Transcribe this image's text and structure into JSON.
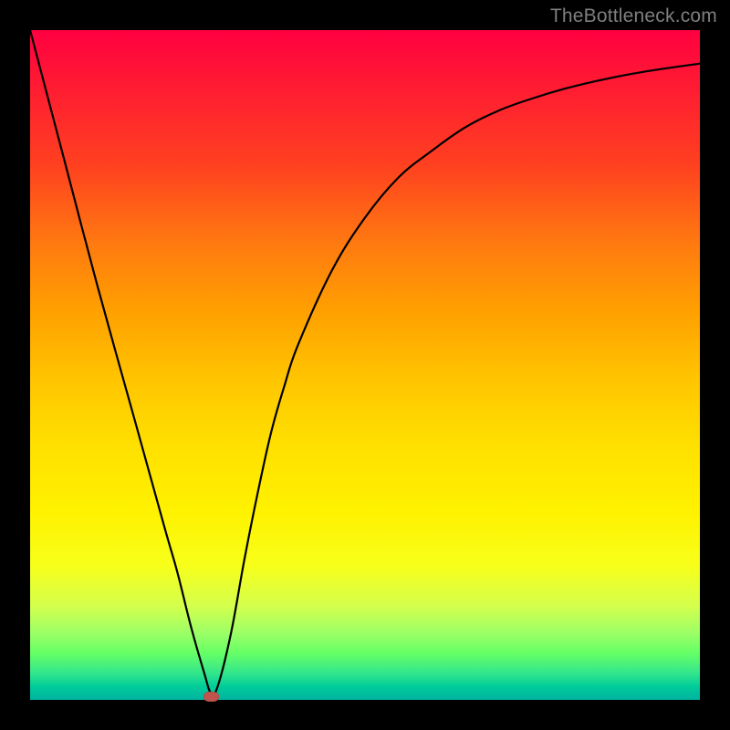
{
  "watermark": "TheBottleneck.com",
  "chart_data": {
    "type": "line",
    "title": "",
    "xlabel": "",
    "ylabel": "",
    "xlim": [
      0,
      100
    ],
    "ylim": [
      0,
      100
    ],
    "grid": false,
    "series": [
      {
        "name": "curve",
        "x": [
          0,
          5,
          10,
          15,
          20,
          22,
          24,
          26,
          27,
          28,
          30,
          32,
          34,
          36,
          38,
          40,
          45,
          50,
          55,
          60,
          65,
          70,
          75,
          80,
          85,
          90,
          95,
          100
        ],
        "values": [
          100,
          81,
          62,
          44,
          26,
          19,
          11,
          4,
          1,
          2,
          10,
          21,
          31,
          40,
          47,
          53,
          64,
          72,
          78,
          82,
          85.5,
          88,
          89.8,
          91.3,
          92.5,
          93.5,
          94.3,
          95
        ]
      }
    ],
    "marker": {
      "x": 27,
      "y": 0.5,
      "color": "#c1554e"
    },
    "background": {
      "type": "vertical-gradient",
      "stops": [
        "#ff0040",
        "#ffa000",
        "#fff200",
        "#00cc99"
      ]
    }
  }
}
